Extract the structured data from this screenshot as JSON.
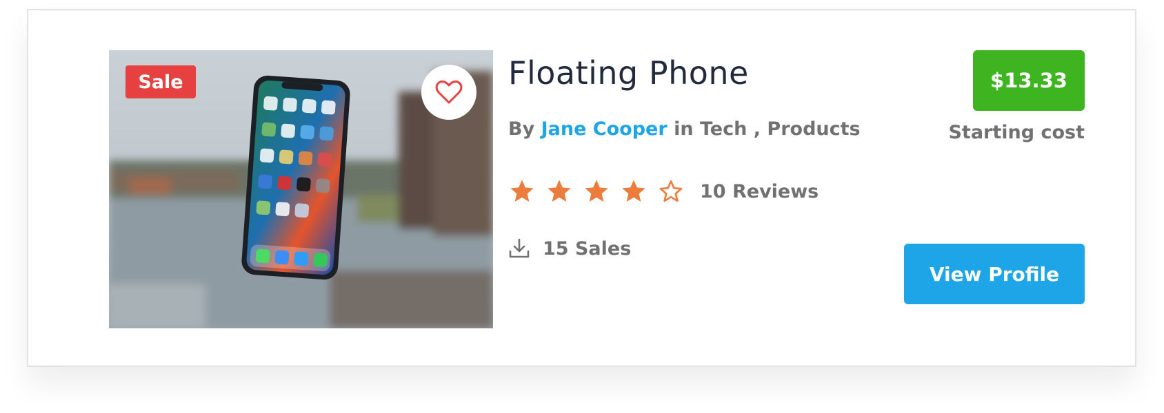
{
  "product": {
    "badge": "Sale",
    "title": "Floating Phone",
    "by_label": "By",
    "author": "Jane Cooper",
    "in_label": "in",
    "categories": [
      "Tech",
      "Products"
    ],
    "category_separator": ",",
    "rating": 4,
    "rating_max": 5,
    "reviews_label": "10 Reviews",
    "sales_label": "15 Sales",
    "price": "$13.33",
    "price_caption": "Starting cost",
    "cta_label": "View Profile"
  },
  "colors": {
    "accent_blue": "#1ea5e8",
    "sale_red": "#e74040",
    "price_green": "#3eb520",
    "star_orange": "#ec7c3c",
    "title_dark": "#222a3e",
    "muted_text": "#717171"
  },
  "icons": {
    "favorite": "heart-outline-icon",
    "star_filled": "star-filled-icon",
    "star_empty": "star-outline-icon",
    "sales": "download-icon"
  }
}
